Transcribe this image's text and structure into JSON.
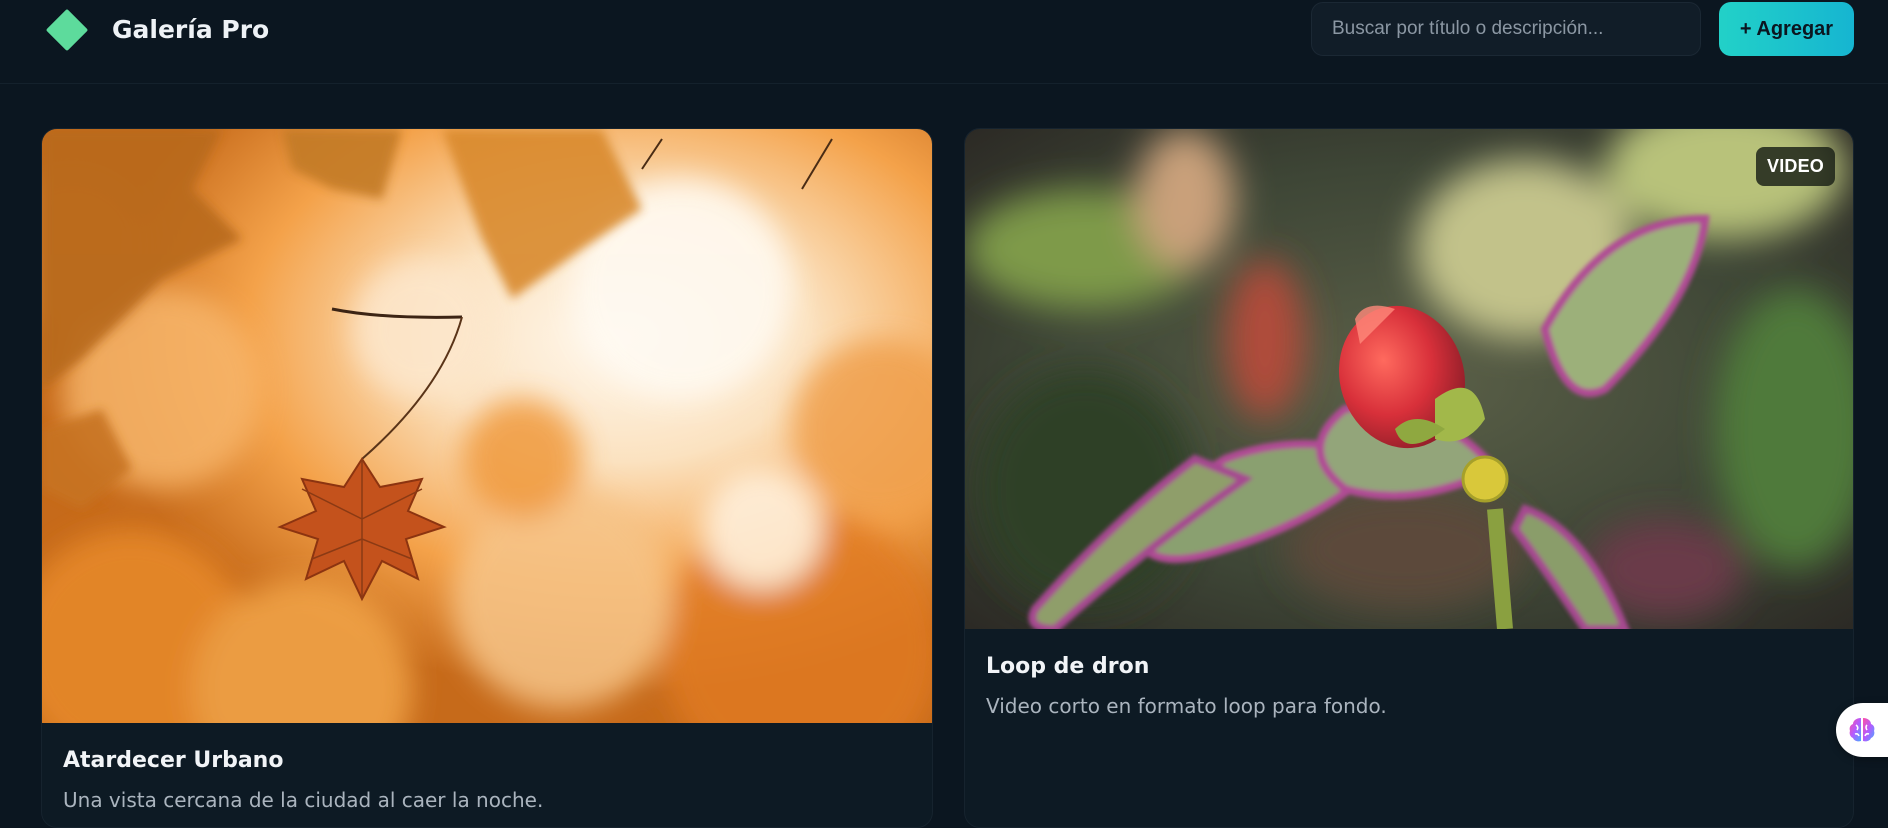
{
  "header": {
    "brand": "Galería Pro",
    "logo_icon": "diamond-logo-icon",
    "search": {
      "placeholder": "Buscar por título o descripción...",
      "value": ""
    },
    "add_button_label": "+ Agregar"
  },
  "gallery": {
    "items": [
      {
        "type": "image",
        "title": "Atardecer Urbano",
        "description": "Una vista cercana de la ciudad al caer la noche.",
        "thumbnail": "autumn-leaves-photo"
      },
      {
        "type": "video",
        "badge": "VIDEO",
        "title": "Loop de dron",
        "description": "Video corto en formato loop para fondo.",
        "thumbnail": "red-flower-bud-photo"
      }
    ]
  },
  "assistant": {
    "icon": "brain-icon"
  },
  "colors": {
    "background": "#0b1620",
    "accent": "#22d1c8",
    "logo": "#5ddb9c",
    "text_primary": "#f1f4f7",
    "text_secondary": "#aab4be"
  }
}
